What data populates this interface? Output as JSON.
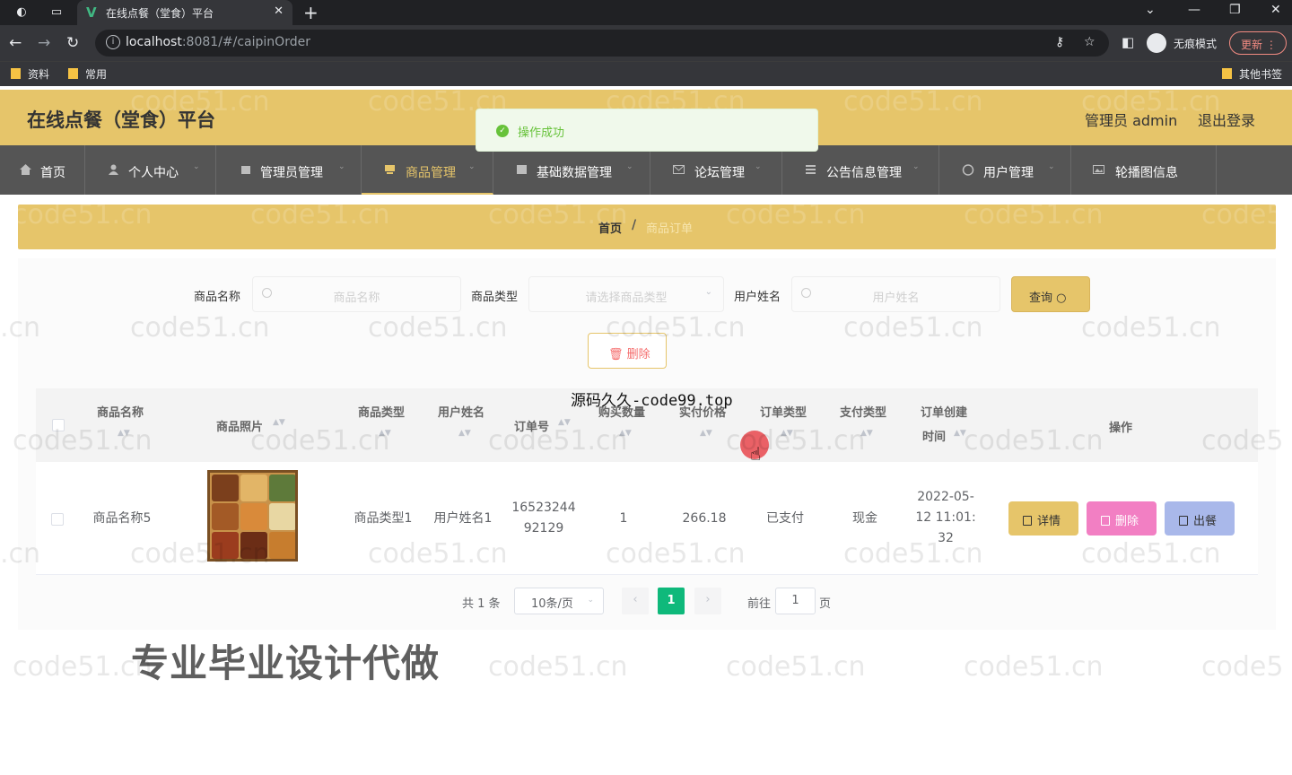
{
  "browser": {
    "tab_title": "在线点餐（堂食）平台",
    "tab_logo": "V",
    "url_host": "localhost",
    "url_path": ":8081/#/caipinOrder",
    "incognito_label": "无痕模式",
    "update_label": "更新",
    "bookmarks": [
      "资料",
      "常用"
    ],
    "other_bookmarks": "其他书签"
  },
  "header": {
    "title": "在线点餐（堂食）平台",
    "admin_label": "管理员 admin",
    "logout_label": "退出登录"
  },
  "toast": {
    "message": "操作成功",
    "color": "#67c23a"
  },
  "menu": {
    "items": [
      "首页",
      "个人中心",
      "管理员管理",
      "商品管理",
      "基础数据管理",
      "论坛管理",
      "公告信息管理",
      "用户管理",
      "轮播图信息"
    ],
    "active_index": 3
  },
  "breadcrumb": {
    "home": "首页",
    "separator": "/",
    "current": "商品订单"
  },
  "search": {
    "name_label": "商品名称",
    "name_placeholder": "商品名称",
    "type_label": "商品类型",
    "type_placeholder": "请选择商品类型",
    "user_label": "用户姓名",
    "user_placeholder": "用户姓名",
    "query_label": "查询",
    "delete_label": "删除"
  },
  "overlay_text": "源码久久-code99.top",
  "table": {
    "headers": [
      "商品名称",
      "商品照片",
      "商品类型",
      "用户姓名",
      "订单号",
      "购买数量",
      "实付价格",
      "订单类型",
      "支付类型",
      "订单创建",
      "时间",
      "操作"
    ],
    "rows": [
      {
        "name": "商品名称5",
        "type": "商品类型1",
        "user": "用户姓名1",
        "order_no_1": "16523244",
        "order_no_2": "92129",
        "quantity": "1",
        "price": "266.18",
        "order_type": "已支付",
        "pay_type": "现金",
        "time_1": "2022-05-",
        "time_2": "12 11:01:",
        "time_3": "32",
        "actions": [
          "详情",
          "删除",
          "出餐"
        ]
      }
    ]
  },
  "pagination": {
    "total": "共 1 条",
    "page_size": "10条/页",
    "current": "1",
    "goto_label": "前往",
    "goto_value": "1",
    "page_suffix": "页"
  },
  "promo_text": "专业毕业设计代做",
  "watermark": "code51.cn",
  "watermark_partial_left": ".cn",
  "watermark_partial_right": "code5",
  "colors": {
    "accent": "#e6c56a",
    "menu_bg": "#555555",
    "detail_btn": "#e6c56a",
    "delete_btn": "#f27fc3",
    "serve_btn": "#a9b8ea",
    "page_active": "#0fb97b"
  }
}
